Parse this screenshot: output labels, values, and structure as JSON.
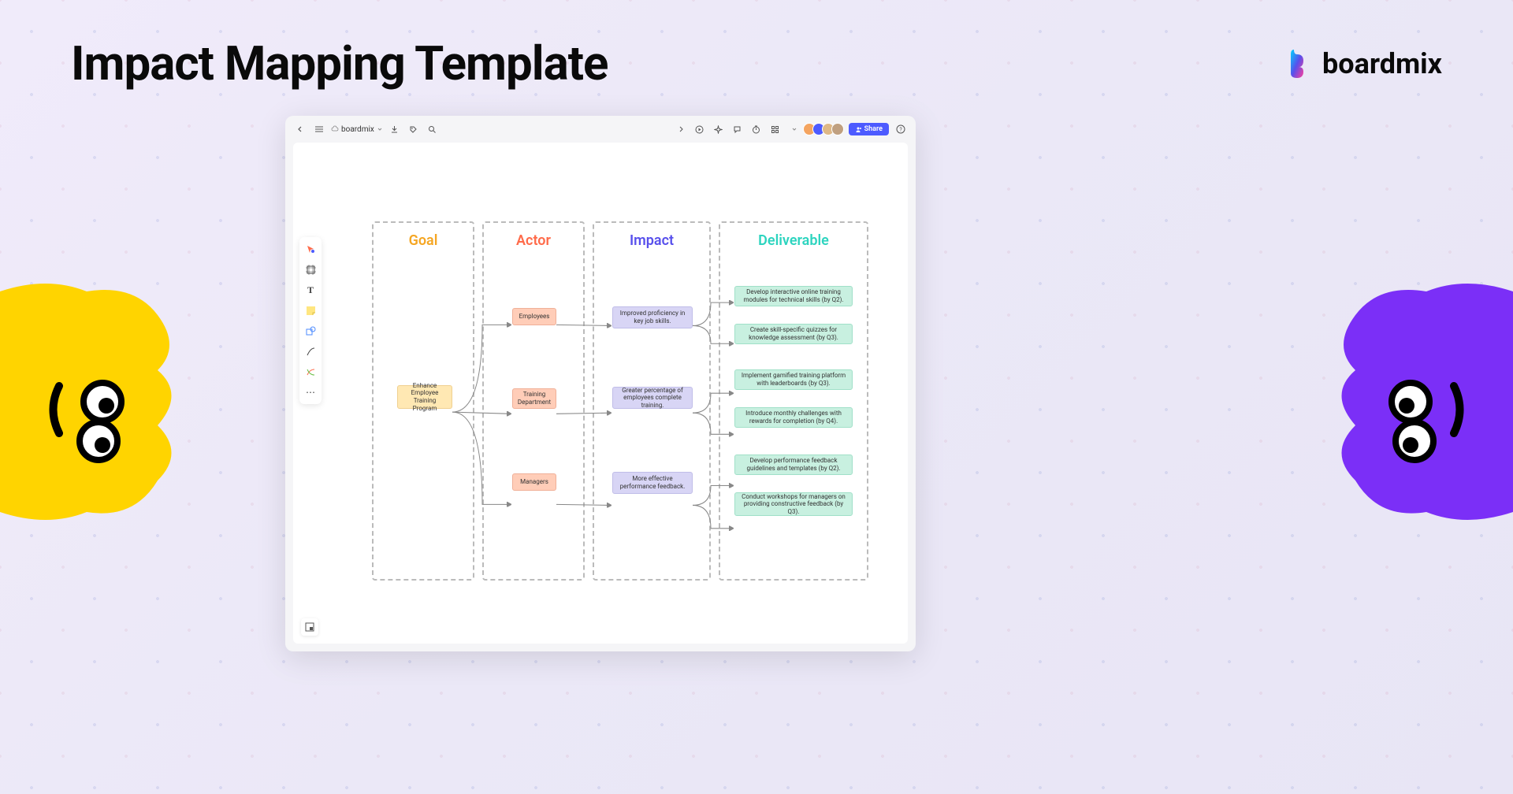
{
  "page": {
    "title": "Impact Mapping Template",
    "brand": "boardmix"
  },
  "topbar": {
    "doc_name": "boardmix",
    "share_label": "Share"
  },
  "avatars": [
    {
      "bg": "#f4a460"
    },
    {
      "bg": "#4d5bff"
    },
    {
      "bg": "#deb887"
    },
    {
      "bg": "#c0a080"
    }
  ],
  "diagram": {
    "columns": [
      {
        "title": "Goal",
        "color": "#f5a623"
      },
      {
        "title": "Actor",
        "color": "#ff6b4a"
      },
      {
        "title": "Impact",
        "color": "#5850ec"
      },
      {
        "title": "Deliverable",
        "color": "#2dd4bf"
      }
    ],
    "goal": "Enhance Employee Training Program",
    "actors": [
      "Employees",
      "Training Department",
      "Managers"
    ],
    "impacts": [
      "Improved proficiency in key job skills.",
      "Greater percentage of employees complete training.",
      "More effective performance feedback."
    ],
    "deliverables": [
      "Develop interactive online training modules for technical skills (by Q2).",
      "Create skill-specific quizzes for knowledge assessment (by Q3).",
      "Implement gamified training platform with leaderboards (by Q3).",
      "Introduce monthly challenges with rewards for completion (by Q4).",
      "Develop performance feedback guidelines and templates (by Q2).",
      "Conduct workshops for managers on providing constructive feedback (by Q3)."
    ]
  }
}
